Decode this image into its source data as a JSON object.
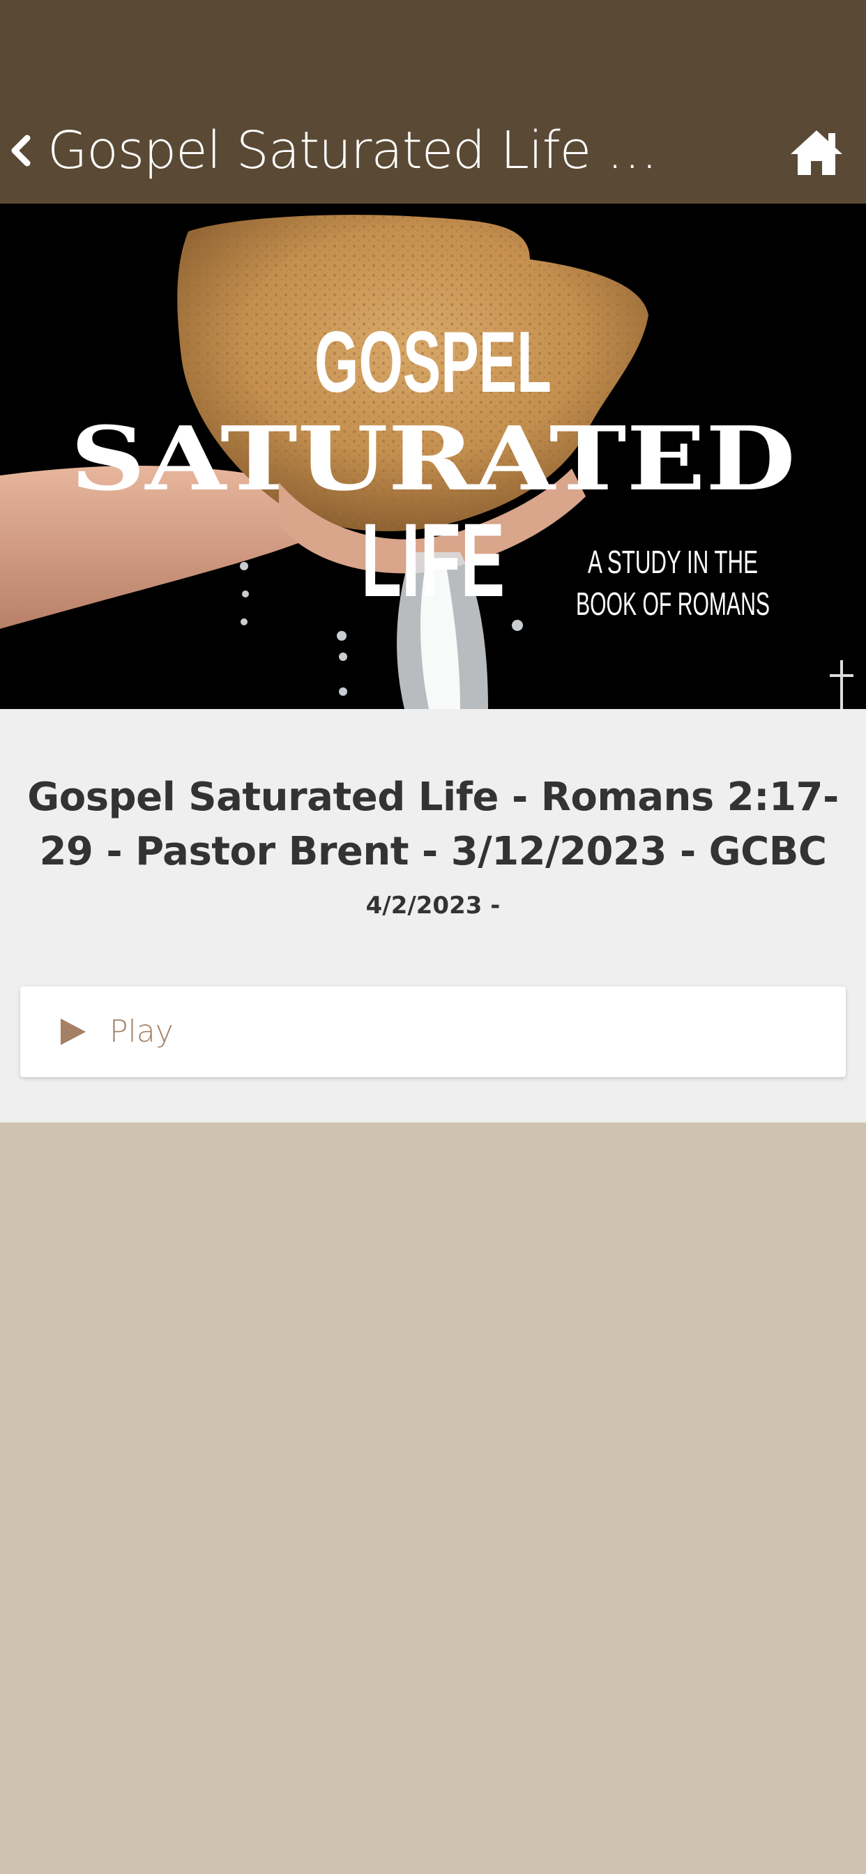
{
  "header": {
    "title": "Gospel Saturated Life - Romans 2:17-29 - Pastor Brent - 3/12/2023 - GCBC",
    "back_icon": "chevron-left-icon",
    "home_icon": "home-icon",
    "background_color": "#5a4a35"
  },
  "hero": {
    "artwork_text": {
      "line1": "GOSPEL",
      "line2": "SATURATED",
      "line3": "LIFE",
      "subtitle_line1": "A STUDY IN THE",
      "subtitle_line2": "BOOK OF ROMANS"
    }
  },
  "sermon": {
    "title": "Gospel Saturated Life - Romans 2:17-29 - Pastor Brent - 3/12/2023 - GCBC",
    "date": "4/2/2023 -"
  },
  "player": {
    "play_label": "Play",
    "play_icon": "play-icon",
    "accent_color": "#a48064"
  },
  "colors": {
    "page_background": "#cfc2b1",
    "content_background": "#efefef",
    "text": "#333333"
  }
}
